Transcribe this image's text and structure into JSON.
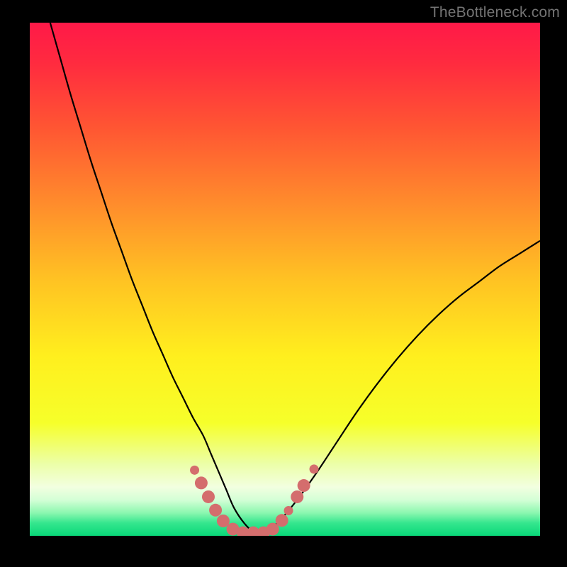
{
  "watermark": "TheBottleneck.com",
  "chart_data": {
    "type": "line",
    "title": "",
    "xlabel": "",
    "ylabel": "",
    "xlim": [
      0,
      100
    ],
    "ylim": [
      0,
      100
    ],
    "background_gradient": {
      "stops": [
        {
          "offset": 0.0,
          "color": "#ff1948"
        },
        {
          "offset": 0.08,
          "color": "#ff2b3f"
        },
        {
          "offset": 0.2,
          "color": "#ff5433"
        },
        {
          "offset": 0.35,
          "color": "#ff8b2c"
        },
        {
          "offset": 0.5,
          "color": "#ffc223"
        },
        {
          "offset": 0.65,
          "color": "#ffef1e"
        },
        {
          "offset": 0.78,
          "color": "#f6ff2a"
        },
        {
          "offset": 0.86,
          "color": "#ecffa8"
        },
        {
          "offset": 0.905,
          "color": "#f2ffe0"
        },
        {
          "offset": 0.93,
          "color": "#d4ffd6"
        },
        {
          "offset": 0.955,
          "color": "#8cf7b0"
        },
        {
          "offset": 0.975,
          "color": "#35e68e"
        },
        {
          "offset": 1.0,
          "color": "#09d879"
        }
      ]
    },
    "series": [
      {
        "name": "bottleneck-curve",
        "color": "#000000",
        "width": 2.2,
        "x": [
          4,
          6,
          8,
          10,
          12,
          14,
          16,
          18,
          20,
          22,
          24,
          26,
          28,
          30,
          32,
          34,
          35.5,
          37,
          38.5,
          40,
          42,
          44,
          46,
          48.5,
          52,
          56,
          60,
          64,
          68,
          72,
          76,
          80,
          84,
          88,
          92,
          96,
          100
        ],
        "y": [
          100,
          93,
          86,
          79.5,
          73,
          67,
          61,
          55.5,
          50,
          45,
          40,
          35.5,
          31,
          27,
          23,
          19.5,
          16,
          12.5,
          9,
          5.5,
          2.5,
          0.7,
          0.7,
          2.5,
          6.5,
          12,
          18,
          24,
          29.5,
          34.5,
          39,
          43,
          46.5,
          49.5,
          52.5,
          55,
          57.5
        ]
      }
    ],
    "markers": {
      "name": "highlight-points",
      "color": "#d46d6d",
      "radius_small": 6.5,
      "radius_large": 9,
      "points": [
        {
          "x": 32.3,
          "y": 12.8,
          "r": "small"
        },
        {
          "x": 33.6,
          "y": 10.3,
          "r": "large"
        },
        {
          "x": 35.0,
          "y": 7.6,
          "r": "large"
        },
        {
          "x": 36.4,
          "y": 5.0,
          "r": "large"
        },
        {
          "x": 37.9,
          "y": 2.9,
          "r": "large"
        },
        {
          "x": 39.8,
          "y": 1.3,
          "r": "large"
        },
        {
          "x": 41.8,
          "y": 0.6,
          "r": "large"
        },
        {
          "x": 43.8,
          "y": 0.6,
          "r": "large"
        },
        {
          "x": 45.8,
          "y": 0.6,
          "r": "large"
        },
        {
          "x": 47.6,
          "y": 1.3,
          "r": "large"
        },
        {
          "x": 49.4,
          "y": 3.0,
          "r": "large"
        },
        {
          "x": 50.7,
          "y": 4.9,
          "r": "small"
        },
        {
          "x": 52.4,
          "y": 7.6,
          "r": "large"
        },
        {
          "x": 53.7,
          "y": 9.8,
          "r": "large"
        },
        {
          "x": 55.7,
          "y": 13.0,
          "r": "small"
        }
      ]
    }
  }
}
